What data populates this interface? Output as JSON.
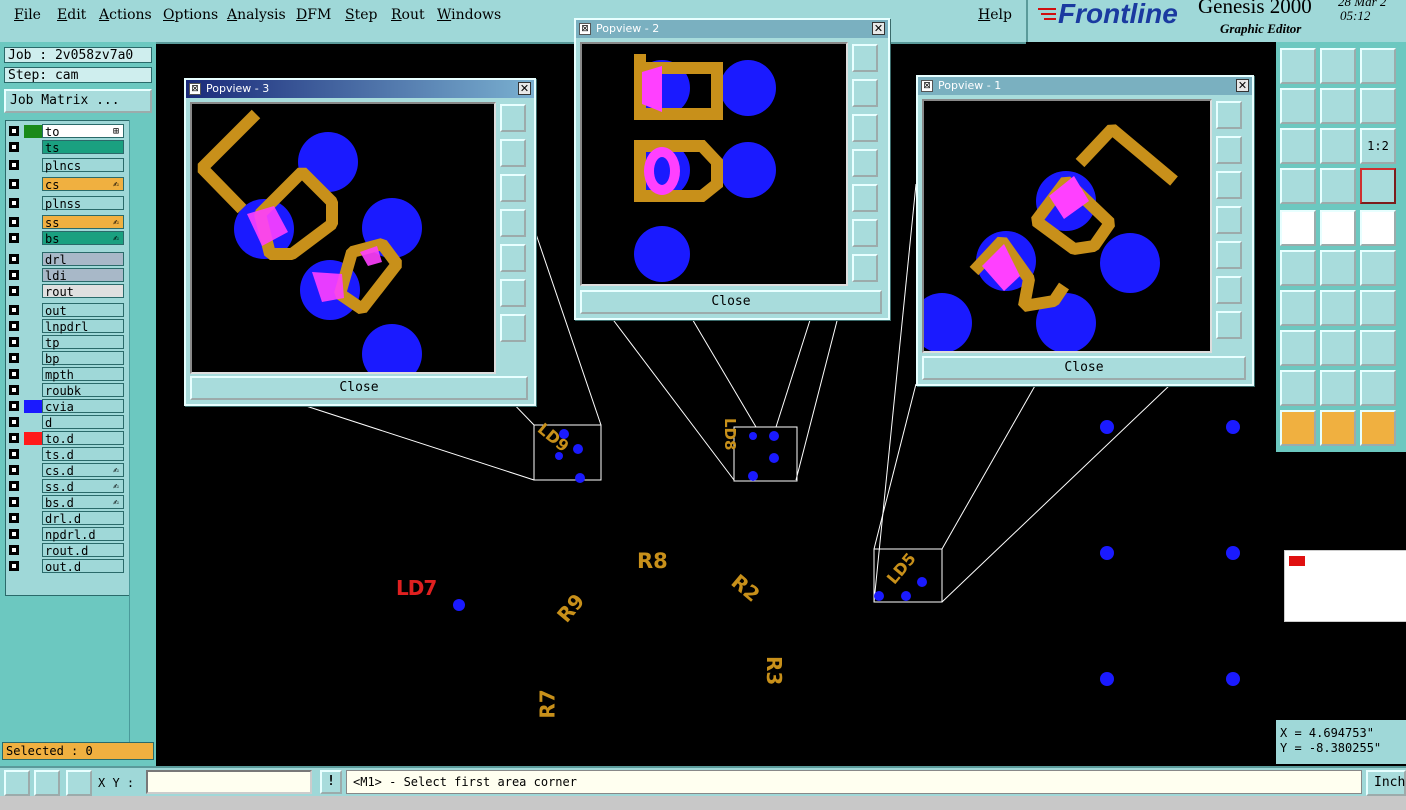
{
  "menu": {
    "items": [
      "File",
      "Edit",
      "Actions",
      "Options",
      "Analysis",
      "DFM",
      "Step",
      "Rout",
      "Windows"
    ],
    "help": "Help"
  },
  "brand": {
    "logo": "Frontline",
    "product": "Genesis 2000",
    "subtitle": "Graphic Editor",
    "date": "28 Mar 2",
    "time": "05:12"
  },
  "job": {
    "job_label": "Job : 2v058zv7a0",
    "step_label": "Step: cam",
    "matrix_button": "Job Matrix ..."
  },
  "layers": [
    {
      "name": "to",
      "color": "#1a8a1a",
      "row_bg": "#ffffff",
      "flag": "⊞"
    },
    {
      "name": "ts",
      "color": "",
      "row_bg": "#1aa080",
      "flag": ""
    },
    {
      "name": "plncs",
      "color": "",
      "row_bg": "#9fd8d8",
      "flag": ""
    },
    {
      "name": "cs",
      "color": "",
      "row_bg": "#f0b040",
      "flag": "✍"
    },
    {
      "name": "plnss",
      "color": "",
      "row_bg": "#9fd8d8",
      "flag": ""
    },
    {
      "name": "ss",
      "color": "",
      "row_bg": "#f0b040",
      "flag": "✍"
    },
    {
      "name": "bs",
      "color": "",
      "row_bg": "#1aa080",
      "flag": "✍"
    },
    {
      "name": "drl",
      "color": "",
      "row_bg": "#a8b8c8",
      "flag": ""
    },
    {
      "name": "ldi",
      "color": "",
      "row_bg": "#a8b8c8",
      "flag": ""
    },
    {
      "name": "rout",
      "color": "",
      "row_bg": "#e0e0e0",
      "flag": ""
    },
    {
      "name": "out",
      "color": "",
      "row_bg": "#9fd8d8",
      "flag": ""
    },
    {
      "name": "lnpdrl",
      "color": "",
      "row_bg": "#9fd8d8",
      "flag": ""
    },
    {
      "name": "tp",
      "color": "",
      "row_bg": "#9fd8d8",
      "flag": ""
    },
    {
      "name": "bp",
      "color": "",
      "row_bg": "#9fd8d8",
      "flag": ""
    },
    {
      "name": "mpth",
      "color": "",
      "row_bg": "#9fd8d8",
      "flag": ""
    },
    {
      "name": "roubk",
      "color": "",
      "row_bg": "#9fd8d8",
      "flag": ""
    },
    {
      "name": "cvia",
      "color": "#1a1aff",
      "row_bg": "#9fd8d8",
      "flag": ""
    },
    {
      "name": "d",
      "color": "",
      "row_bg": "#9fd8d8",
      "flag": ""
    },
    {
      "name": "to.d",
      "color": "#ff1a1a",
      "row_bg": "#9fd8d8",
      "flag": ""
    },
    {
      "name": "ts.d",
      "color": "",
      "row_bg": "#9fd8d8",
      "flag": ""
    },
    {
      "name": "cs.d",
      "color": "",
      "row_bg": "#9fd8d8",
      "flag": "✍"
    },
    {
      "name": "ss.d",
      "color": "",
      "row_bg": "#9fd8d8",
      "flag": "✍"
    },
    {
      "name": "bs.d",
      "color": "",
      "row_bg": "#9fd8d8",
      "flag": "✍"
    },
    {
      "name": "drl.d",
      "color": "",
      "row_bg": "#9fd8d8",
      "flag": ""
    },
    {
      "name": "npdrl.d",
      "color": "",
      "row_bg": "#9fd8d8",
      "flag": ""
    },
    {
      "name": "rout.d",
      "color": "",
      "row_bg": "#9fd8d8",
      "flag": ""
    },
    {
      "name": "out.d",
      "color": "",
      "row_bg": "#9fd8d8",
      "flag": ""
    }
  ],
  "selected": "Selected : 0",
  "popviews": [
    {
      "title": "Popview - 3",
      "close": "Close"
    },
    {
      "title": "Popview - 2",
      "close": "Close"
    },
    {
      "title": "Popview - 1",
      "close": "Close"
    }
  ],
  "board_labels": [
    "LD9",
    "LD8",
    "LD7",
    "R8",
    "R9",
    "R2",
    "R3",
    "R7",
    "LD5"
  ],
  "coords": {
    "x": "X = 4.694753\"",
    "y": "Y = -8.380255\""
  },
  "status": {
    "xy_label": "X Y :",
    "xy_value": "",
    "message": "<M1> - Select first area corner",
    "units": "Inch"
  },
  "colors": {
    "pad_blue": "#1a1aff",
    "trace_gold": "#c8901a",
    "mask_magenta": "#ff40ff",
    "panel": "#9fd8d8"
  }
}
